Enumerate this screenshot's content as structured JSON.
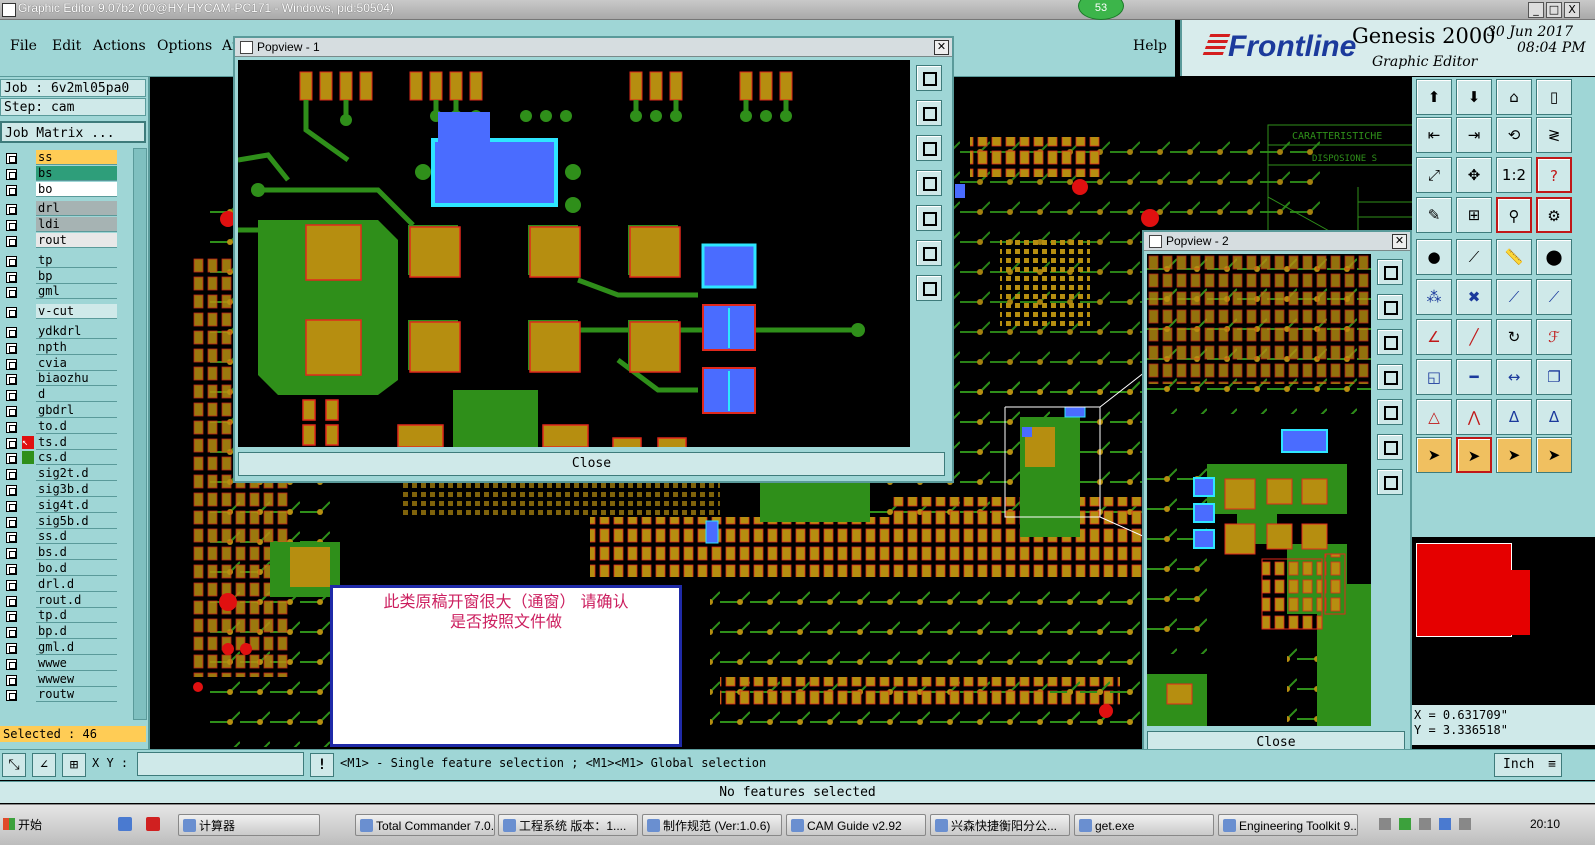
{
  "window": {
    "title": "Graphic Editor 9.07b2 (00@HY-HYCAM-PC171 - Windows, pid:50504)",
    "badge_count": "53",
    "min_label": "_",
    "max_label": "□",
    "close_label": "X"
  },
  "menubar": {
    "file": "File",
    "edit": "Edit",
    "actions": "Actions",
    "options": "Options",
    "analysis_partial": "An",
    "help": "Help"
  },
  "logo": {
    "brand": "Frontline",
    "product": "Genesis 2000",
    "subtitle": "Graphic Editor",
    "date": "30 Jun 2017",
    "time": "08:04 PM"
  },
  "left_panel": {
    "job": "Job : 6v2ml05pa0",
    "step": "Step: cam",
    "job_matrix": "Job Matrix ...",
    "selected": "Selected : 46",
    "layers": [
      {
        "name": "ss",
        "color": "#ffcc55"
      },
      {
        "name": "bs",
        "color": "#2e9e7a"
      },
      {
        "name": "bo",
        "color": "#ffffff"
      },
      {
        "name": "drl",
        "color": "#a6b3b3"
      },
      {
        "name": "ldi",
        "color": "#a6b3b3"
      },
      {
        "name": "rout",
        "color": "#e8e8e8"
      },
      {
        "name": "tp",
        "color": "#9fd6d6"
      },
      {
        "name": "bp",
        "color": "#9fd6d6"
      },
      {
        "name": "gml",
        "color": "#9fd6d6"
      },
      {
        "name": "v-cut",
        "color": "#cfe9e9"
      },
      {
        "name": "ydkdrl",
        "color": "#9fd6d6"
      },
      {
        "name": "npth",
        "color": "#9fd6d6"
      },
      {
        "name": "cvia",
        "color": "#9fd6d6"
      },
      {
        "name": "biaozhu",
        "color": "#9fd6d6"
      },
      {
        "name": "d",
        "color": "#9fd6d6"
      },
      {
        "name": "gbdrl",
        "color": "#9fd6d6"
      },
      {
        "name": "to.d",
        "color": "#9fd6d6"
      },
      {
        "name": "ts.d",
        "color": "#9fd6d6"
      },
      {
        "name": "cs.d",
        "color": "#9fd6d6"
      },
      {
        "name": "sig2t.d",
        "color": "#9fd6d6"
      },
      {
        "name": "sig3b.d",
        "color": "#9fd6d6"
      },
      {
        "name": "sig4t.d",
        "color": "#9fd6d6"
      },
      {
        "name": "sig5b.d",
        "color": "#9fd6d6"
      },
      {
        "name": "ss.d",
        "color": "#9fd6d6"
      },
      {
        "name": "bs.d",
        "color": "#9fd6d6"
      },
      {
        "name": "bo.d",
        "color": "#9fd6d6"
      },
      {
        "name": "drl.d",
        "color": "#9fd6d6"
      },
      {
        "name": "rout.d",
        "color": "#9fd6d6"
      },
      {
        "name": "tp.d",
        "color": "#9fd6d6"
      },
      {
        "name": "bp.d",
        "color": "#9fd6d6"
      },
      {
        "name": "gml.d",
        "color": "#9fd6d6"
      },
      {
        "name": "wwwe",
        "color": "#9fd6d6"
      },
      {
        "name": "wwwew",
        "color": "#9fd6d6"
      },
      {
        "name": "routw",
        "color": "#9fd6d6"
      }
    ]
  },
  "canvas": {
    "annotation_line1": "CARATTERISTICHE",
    "annotation_line2": "DISPOSIONE S"
  },
  "popview1": {
    "title": "Popview - 1",
    "close": "Close"
  },
  "popview2": {
    "title": "Popview - 2",
    "close": "Close"
  },
  "note": {
    "text_line1": "此类原稿开窗很大（通窗）   请确认",
    "text_line2": "是否按照文件做"
  },
  "toolbar_labels": {
    "ratio": "1:2",
    "help": "?"
  },
  "coords": {
    "x": "X = 0.631709\"",
    "y": "Y = 3.336518\""
  },
  "bottom": {
    "xy_label": "X Y :",
    "hint": "<M1> - Single feature selection ; <M1><M1> Global selection",
    "units": "Inch",
    "status": "No features selected"
  },
  "taskbar": {
    "start": "开始",
    "items": [
      "计算器",
      "Total Commander 7.0...",
      "工程系统  版本：1....",
      "制作规范 (Ver:1.0.6)",
      "CAM  Guide v2.92",
      "兴森快捷衡阳分公...",
      "get.exe",
      "Engineering Toolkit 9...."
    ],
    "clock": "20:10"
  },
  "colors": {
    "panel": "#9fd6d6",
    "copper": "#2f8f1a",
    "pad": "#b68e10",
    "pad_border": "#e0281c",
    "smd": "#4a6cff",
    "smd_outline": "#2ee6ff",
    "note_text": "#cc1f5f"
  }
}
